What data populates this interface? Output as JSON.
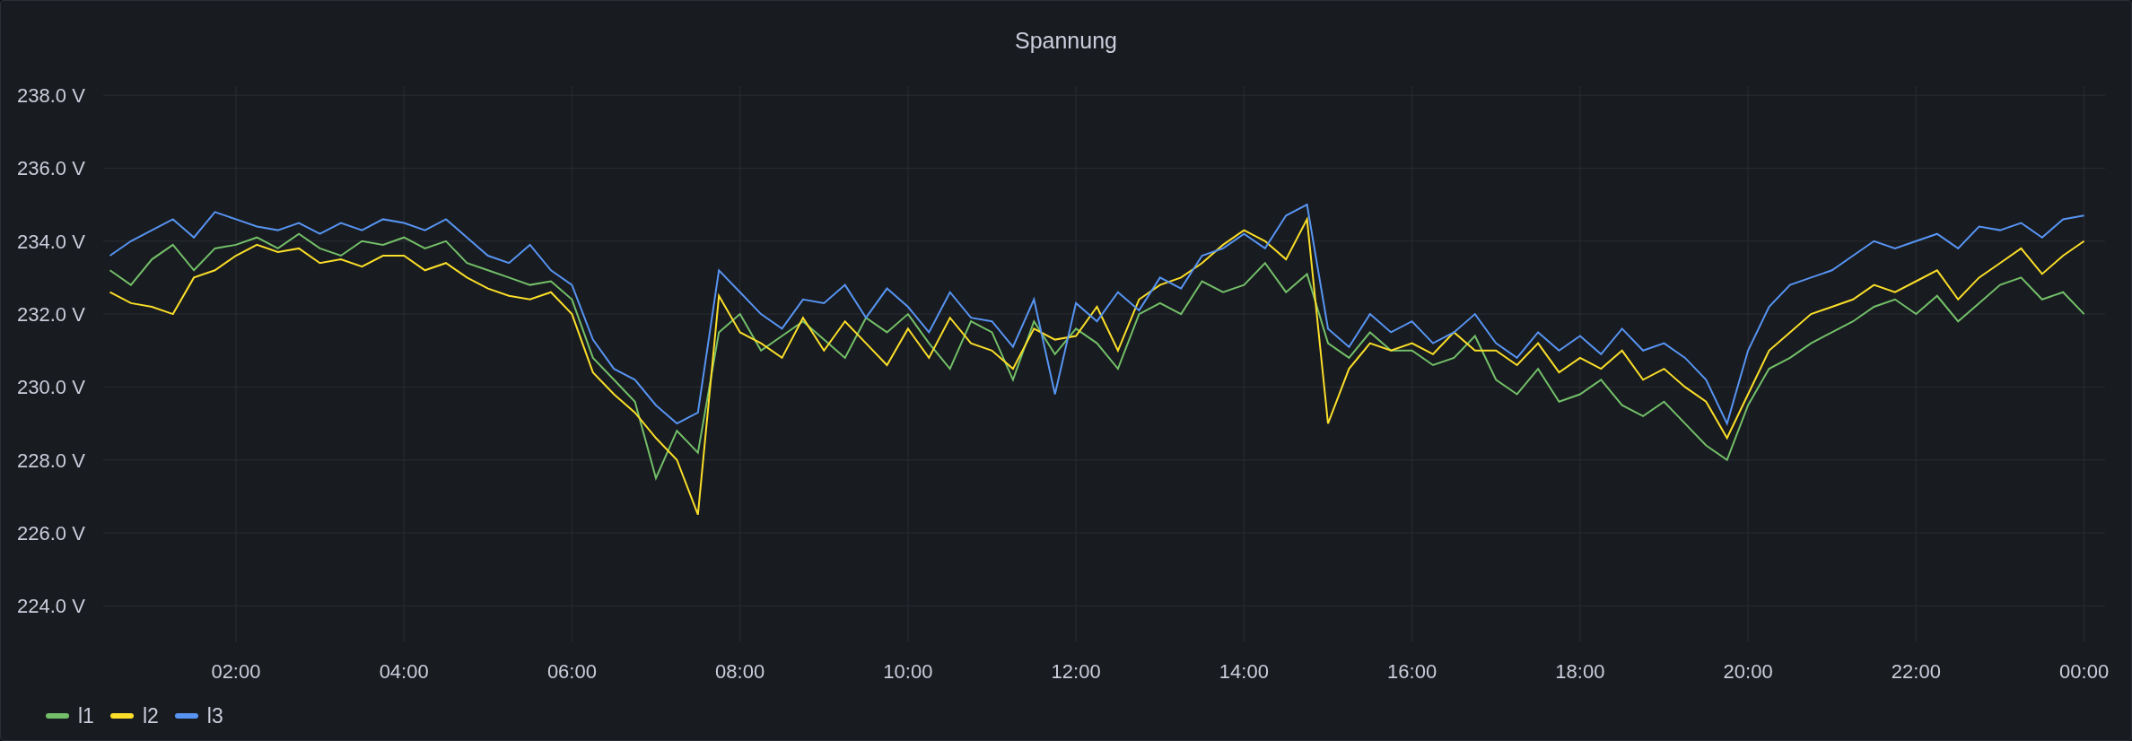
{
  "panel": {
    "title": "Spannung",
    "chart_data": {
      "type": "line",
      "x": [
        0.5,
        0.75,
        1,
        1.25,
        1.5,
        1.75,
        2,
        2.25,
        2.5,
        2.75,
        3,
        3.25,
        3.5,
        3.75,
        4,
        4.25,
        4.5,
        4.75,
        5,
        5.25,
        5.5,
        5.75,
        6,
        6.25,
        6.5,
        6.75,
        7,
        7.25,
        7.5,
        7.75,
        8,
        8.25,
        8.5,
        8.75,
        9,
        9.25,
        9.5,
        9.75,
        10,
        10.25,
        10.5,
        10.75,
        11,
        11.25,
        11.5,
        11.75,
        12,
        12.25,
        12.5,
        12.75,
        13,
        13.25,
        13.5,
        13.75,
        14,
        14.25,
        14.5,
        14.75,
        15,
        15.25,
        15.5,
        15.75,
        16,
        16.25,
        16.5,
        16.75,
        17,
        17.25,
        17.5,
        17.75,
        18,
        18.25,
        18.5,
        18.75,
        19,
        19.25,
        19.5,
        19.75,
        20,
        20.25,
        20.5,
        20.75,
        21,
        21.25,
        21.5,
        21.75,
        22,
        22.25,
        22.5,
        22.75,
        23,
        23.25,
        23.5,
        23.75,
        24
      ],
      "series": [
        {
          "name": "l1",
          "color": "#73bf69",
          "values": [
            233.2,
            232.8,
            233.5,
            233.9,
            233.2,
            233.8,
            233.9,
            234.1,
            233.8,
            234.2,
            233.8,
            233.6,
            234.0,
            233.9,
            234.1,
            233.8,
            234.0,
            233.4,
            233.2,
            233.0,
            232.8,
            232.9,
            232.4,
            230.8,
            230.2,
            229.6,
            227.5,
            228.8,
            228.2,
            231.5,
            232.0,
            231.0,
            231.4,
            231.8,
            231.3,
            230.8,
            231.9,
            231.5,
            232.0,
            231.2,
            230.5,
            231.8,
            231.5,
            230.2,
            231.8,
            230.9,
            231.6,
            231.2,
            230.5,
            232.0,
            232.3,
            232.0,
            232.9,
            232.6,
            232.8,
            233.4,
            232.6,
            233.1,
            231.2,
            230.8,
            231.5,
            231.0,
            231.0,
            230.6,
            230.8,
            231.4,
            230.2,
            229.8,
            230.5,
            229.6,
            229.8,
            230.2,
            229.5,
            229.2,
            229.6,
            229.0,
            228.4,
            228.0,
            229.5,
            230.5,
            230.8,
            231.2,
            231.5,
            231.8,
            232.2,
            232.4,
            232.0,
            232.5,
            231.8,
            232.3,
            232.8,
            233.0,
            232.4,
            232.6,
            232.0
          ]
        },
        {
          "name": "l2",
          "color": "#fade2a",
          "values": [
            232.6,
            232.3,
            232.2,
            232.0,
            233.0,
            233.2,
            233.6,
            233.9,
            233.7,
            233.8,
            233.4,
            233.5,
            233.3,
            233.6,
            233.6,
            233.2,
            233.4,
            233.0,
            232.7,
            232.5,
            232.4,
            232.6,
            232.0,
            230.4,
            229.8,
            229.3,
            228.6,
            228.0,
            226.5,
            232.5,
            231.5,
            231.2,
            230.8,
            231.9,
            231.0,
            231.8,
            231.2,
            230.6,
            231.6,
            230.8,
            231.9,
            231.2,
            231.0,
            230.5,
            231.6,
            231.3,
            231.4,
            232.2,
            231.0,
            232.4,
            232.8,
            233.0,
            233.4,
            233.9,
            234.3,
            234.0,
            233.5,
            234.6,
            229.0,
            230.5,
            231.2,
            231.0,
            231.2,
            230.9,
            231.5,
            231.0,
            231.0,
            230.6,
            231.2,
            230.4,
            230.8,
            230.5,
            231.0,
            230.2,
            230.5,
            230.0,
            229.6,
            228.6,
            229.8,
            231.0,
            231.5,
            232.0,
            232.2,
            232.4,
            232.8,
            232.6,
            232.9,
            233.2,
            232.4,
            233.0,
            233.4,
            233.8,
            233.1,
            233.6,
            234.0
          ]
        },
        {
          "name": "l3",
          "color": "#5794f2",
          "values": [
            233.6,
            234.0,
            234.3,
            234.6,
            234.1,
            234.8,
            234.6,
            234.4,
            234.3,
            234.5,
            234.2,
            234.5,
            234.3,
            234.6,
            234.5,
            234.3,
            234.6,
            234.1,
            233.6,
            233.4,
            233.9,
            233.2,
            232.8,
            231.3,
            230.5,
            230.2,
            229.5,
            229.0,
            229.3,
            233.2,
            232.6,
            232.0,
            231.6,
            232.4,
            232.3,
            232.8,
            231.9,
            232.7,
            232.2,
            231.5,
            232.6,
            231.9,
            231.8,
            231.1,
            232.4,
            229.8,
            232.3,
            231.8,
            232.6,
            232.1,
            233.0,
            232.7,
            233.6,
            233.8,
            234.2,
            233.8,
            234.7,
            235.0,
            231.6,
            231.1,
            232.0,
            231.5,
            231.8,
            231.2,
            231.5,
            232.0,
            231.2,
            230.8,
            231.5,
            231.0,
            231.4,
            230.9,
            231.6,
            231.0,
            231.2,
            230.8,
            230.2,
            229.0,
            231.0,
            232.2,
            232.8,
            233.0,
            233.2,
            233.6,
            234.0,
            233.8,
            234.0,
            234.2,
            233.8,
            234.4,
            234.3,
            234.5,
            234.1,
            234.6,
            234.7
          ]
        }
      ],
      "grid": true,
      "xlim": [
        0.42,
        24.25
      ],
      "ylim": [
        223,
        238.25
      ],
      "xticks": [
        {
          "value": 2,
          "label": "02:00"
        },
        {
          "value": 4,
          "label": "04:00"
        },
        {
          "value": 6,
          "label": "06:00"
        },
        {
          "value": 8,
          "label": "08:00"
        },
        {
          "value": 10,
          "label": "10:00"
        },
        {
          "value": 12,
          "label": "12:00"
        },
        {
          "value": 14,
          "label": "14:00"
        },
        {
          "value": 16,
          "label": "16:00"
        },
        {
          "value": 18,
          "label": "18:00"
        },
        {
          "value": 20,
          "label": "20:00"
        },
        {
          "value": 22,
          "label": "22:00"
        },
        {
          "value": 24,
          "label": "00:00"
        }
      ],
      "yticks": [
        {
          "value": 224,
          "label": "224.0 V"
        },
        {
          "value": 226,
          "label": "226.0 V"
        },
        {
          "value": 228,
          "label": "228.0 V"
        },
        {
          "value": 230,
          "label": "230.0 V"
        },
        {
          "value": 232,
          "label": "232.0 V"
        },
        {
          "value": 234,
          "label": "234.0 V"
        },
        {
          "value": 236,
          "label": "236.0 V"
        },
        {
          "value": 238,
          "label": "238.0 V"
        }
      ]
    }
  }
}
